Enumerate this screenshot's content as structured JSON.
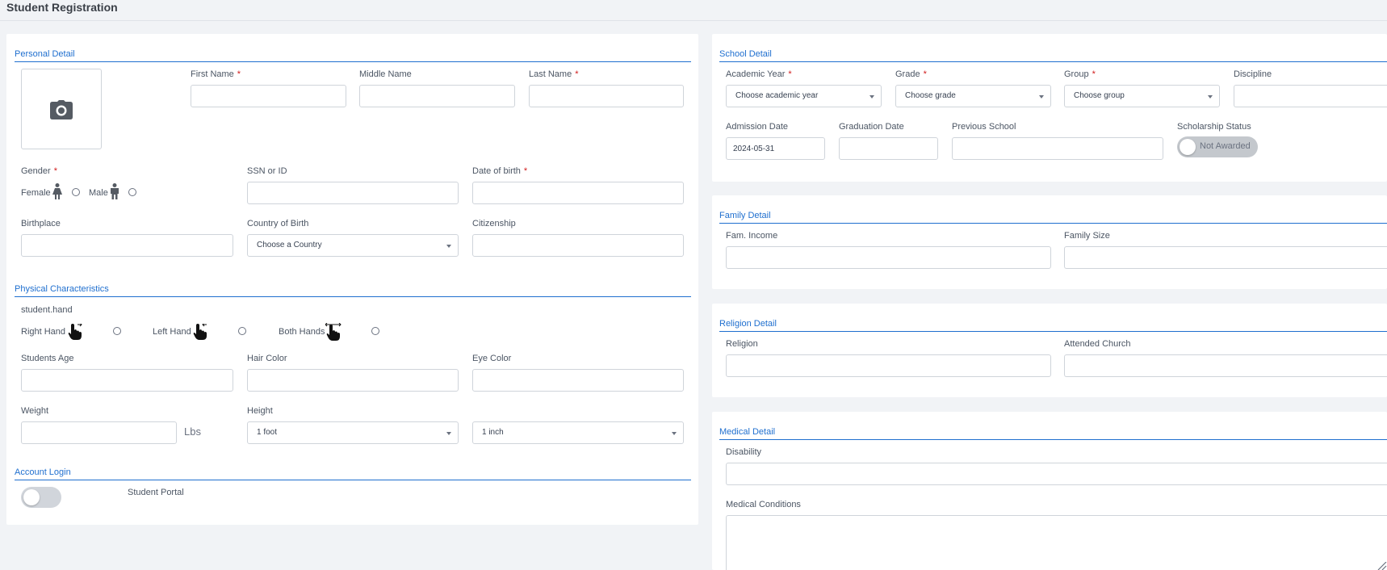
{
  "page": {
    "title": "Student Registration"
  },
  "personal": {
    "section_title": "Personal Detail",
    "first_name_label": "First Name",
    "middle_name_label": "Middle Name",
    "last_name_label": "Last Name",
    "required_mark": "*",
    "gender_label": "Gender",
    "female_label": "Female",
    "male_label": "Male",
    "ssn_label": "SSN or ID",
    "dob_label": "Date of birth",
    "birthplace_label": "Birthplace",
    "country_label": "Country of Birth",
    "country_value": "Choose a Country",
    "citizenship_label": "Citizenship"
  },
  "physical": {
    "section_title": "Physical Characteristics",
    "hand_label": "student.hand",
    "right_hand": "Right Hand",
    "left_hand": "Left Hand",
    "both_hands": "Both Hands",
    "age_label": "Students Age",
    "hair_label": "Hair Color",
    "eye_label": "Eye Color",
    "weight_label": "Weight",
    "weight_unit": "Lbs",
    "height_label": "Height",
    "height_feet": "1 foot",
    "height_inches": "1 inch"
  },
  "account": {
    "section_title": "Account Login",
    "portal_label": "Student Portal"
  },
  "school": {
    "section_title": "School Detail",
    "academic_year_label": "Academic Year",
    "academic_year_value": "Choose academic year",
    "grade_label": "Grade",
    "grade_value": "Choose grade",
    "group_label": "Group",
    "group_value": "Choose group",
    "discipline_label": "Discipline",
    "admission_label": "Admission Date",
    "admission_value": "2024-05-31",
    "graduation_label": "Graduation Date",
    "previous_school_label": "Previous School",
    "scholarship_label": "Scholarship Status",
    "scholarship_value": "Not Awarded"
  },
  "family": {
    "section_title": "Family Detail",
    "income_label": "Fam. Income",
    "size_label": "Family Size"
  },
  "religion": {
    "section_title": "Religion Detail",
    "religion_label": "Religion",
    "church_label": "Attended Church"
  },
  "medical": {
    "section_title": "Medical Detail",
    "disability_label": "Disability",
    "conditions_label": "Medical Conditions"
  },
  "colors": {
    "accent": "#1f6fcf",
    "required": "#d11c1c",
    "background": "#f1f3f6"
  },
  "icons": {
    "photo": "camera-icon",
    "female": "female-icon",
    "male": "male-icon",
    "right_hand": "right-hand-pointer-icon",
    "left_hand": "left-hand-pointer-icon",
    "both_hands": "both-hands-pointer-icon"
  }
}
